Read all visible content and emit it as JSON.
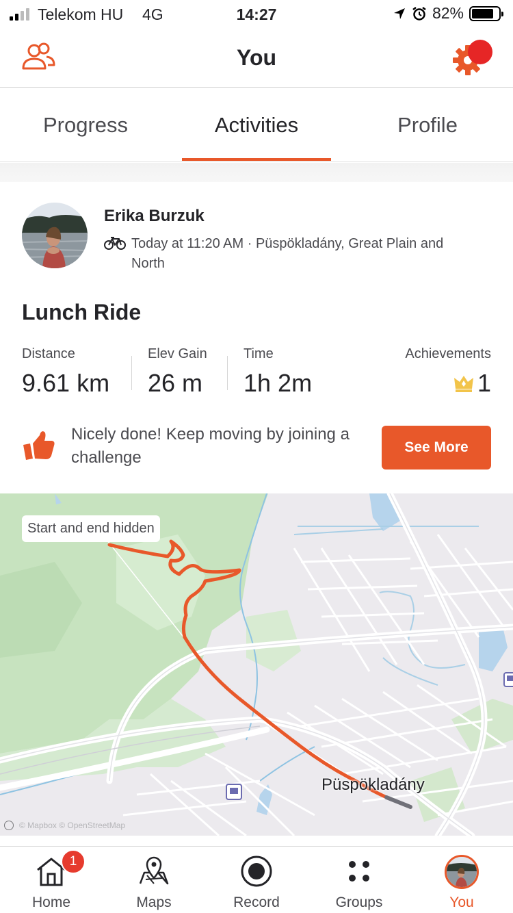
{
  "status_bar": {
    "carrier": "Telekom HU",
    "network": "4G",
    "time": "14:27",
    "battery": "82%",
    "icons": [
      "signal-icon",
      "location-arrow-icon",
      "alarm-icon",
      "battery-icon"
    ]
  },
  "header": {
    "title": "You",
    "left_icon": "friends-icon",
    "right_icon": "settings-gear-icon"
  },
  "tabs": [
    {
      "label": "Progress",
      "active": false
    },
    {
      "label": "Activities",
      "active": true
    },
    {
      "label": "Profile",
      "active": false
    }
  ],
  "activity": {
    "athlete": "Erika Burzuk",
    "type_icon": "bike-icon",
    "meta": "Today at 11:20 AM · Püspökladány, Great Plain and North",
    "title": "Lunch Ride",
    "stats": [
      {
        "label": "Distance",
        "value": "9.61 km"
      },
      {
        "label": "Elev Gain",
        "value": "26 m"
      },
      {
        "label": "Time",
        "value": "1h 2m"
      }
    ],
    "achievements": {
      "label": "Achievements",
      "value": "1",
      "icon": "crown-icon"
    },
    "promo": {
      "text": "Nicely done! Keep moving by joining a challenge",
      "icon": "thumbs-up-icon",
      "button": "See More"
    }
  },
  "map": {
    "pill": "Start and end hidden",
    "town": "Püspökladány",
    "attribution": "© Mapbox © OpenStreetMap",
    "route_color": "#e8582a"
  },
  "bottom_nav": [
    {
      "label": "Home",
      "icon": "home-icon",
      "badge": "1"
    },
    {
      "label": "Maps",
      "icon": "map-pin-icon"
    },
    {
      "label": "Record",
      "icon": "record-icon"
    },
    {
      "label": "Groups",
      "icon": "groups-icon"
    },
    {
      "label": "You",
      "icon": "avatar",
      "active": true
    }
  ],
  "colors": {
    "accent": "#e8582a",
    "badge": "#e63b2e",
    "text": "#242428"
  }
}
